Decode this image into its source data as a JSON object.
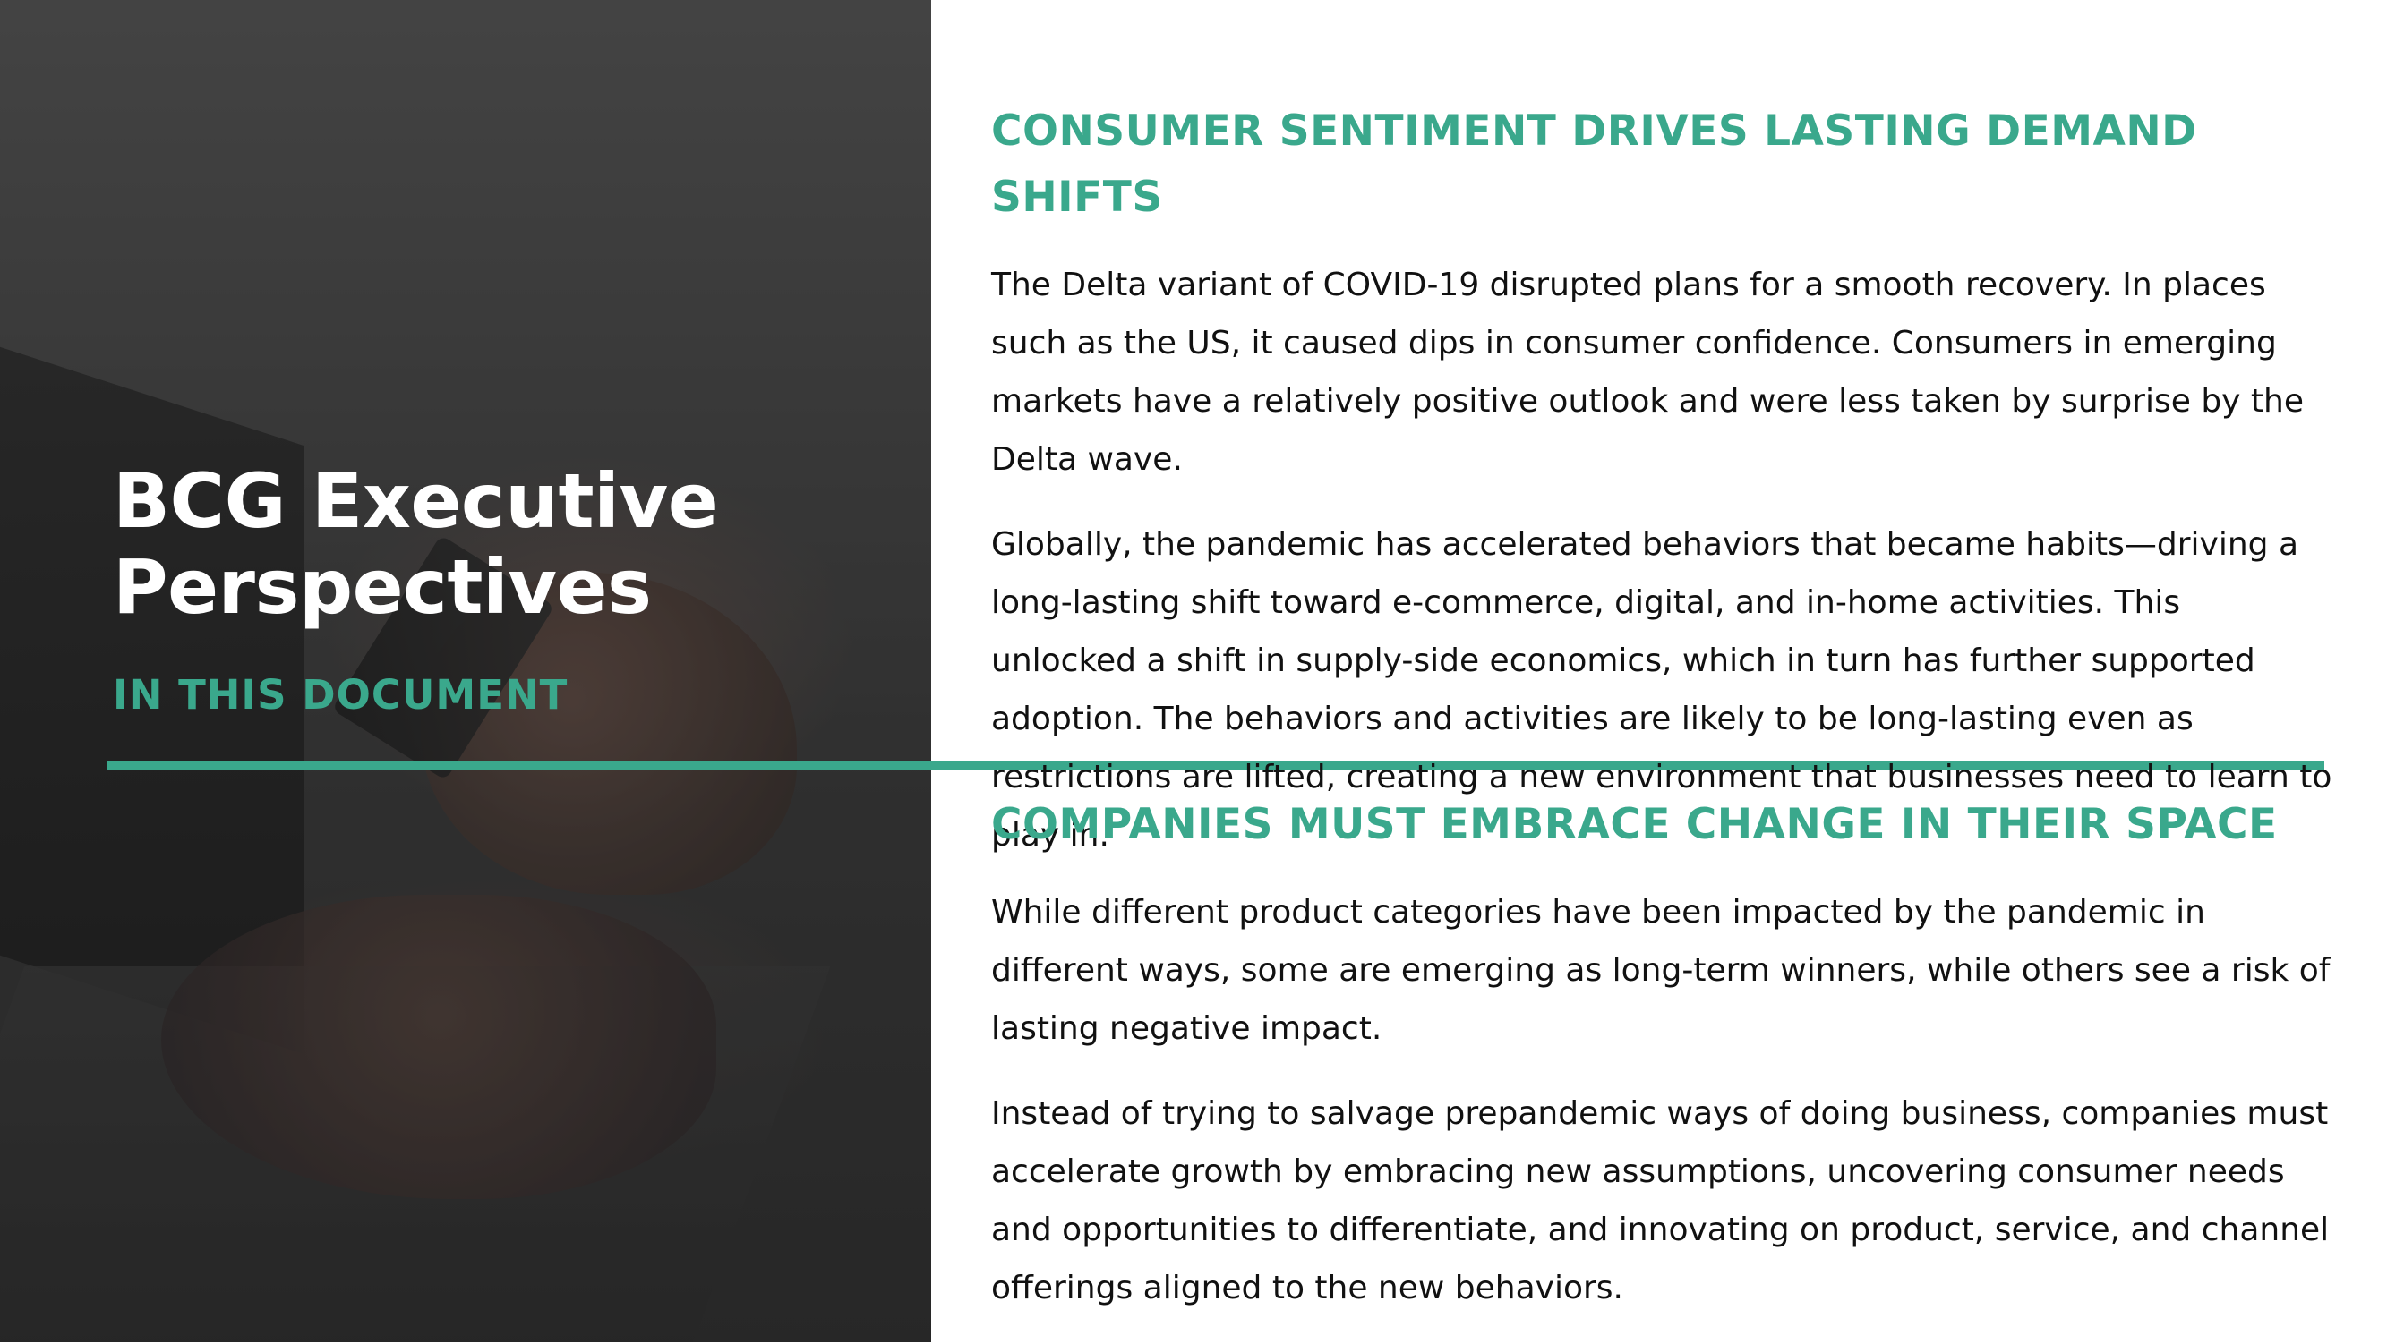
{
  "left_panel": {
    "title_line1": "BCG Executive",
    "title_line2": "Perspectives",
    "subtitle": "IN THIS DOCUMENT"
  },
  "sections": [
    {
      "heading": "CONSUMER SENTIMENT DRIVES LASTING DEMAND SHIFTS",
      "paragraphs": [
        "The Delta variant of COVID-19 disrupted plans for a smooth recovery. In places such as the US, it caused dips in consumer confidence. Consumers in emerging markets have a relatively positive outlook and were less taken by surprise by the Delta wave.",
        "Globally, the pandemic has accelerated behaviors that became habits—driving a long-lasting shift toward e-commerce, digital, and in-home activities. This unlocked a shift in supply-side economics, which in turn has further supported adoption. The behaviors and activities are likely to be long-lasting even as restrictions are lifted, creating a new environment that businesses need to learn to play in."
      ]
    },
    {
      "heading": "COMPANIES MUST EMBRACE CHANGE IN THEIR SPACE",
      "paragraphs": [
        "While different product categories have been impacted by the pandemic in different ways, some are emerging as long-term winners, while others see a risk of lasting negative impact.",
        "Instead of trying to salvage prepandemic ways of doing business, companies must accelerate growth by embracing new assumptions, uncovering consumer needs and opportunities to differentiate, and innovating on product, service, and channel offerings aligned to the new behaviors."
      ]
    }
  ],
  "colors": {
    "accent": "#3aa88c",
    "text": "#111111",
    "panel": "#3a3a3a"
  }
}
